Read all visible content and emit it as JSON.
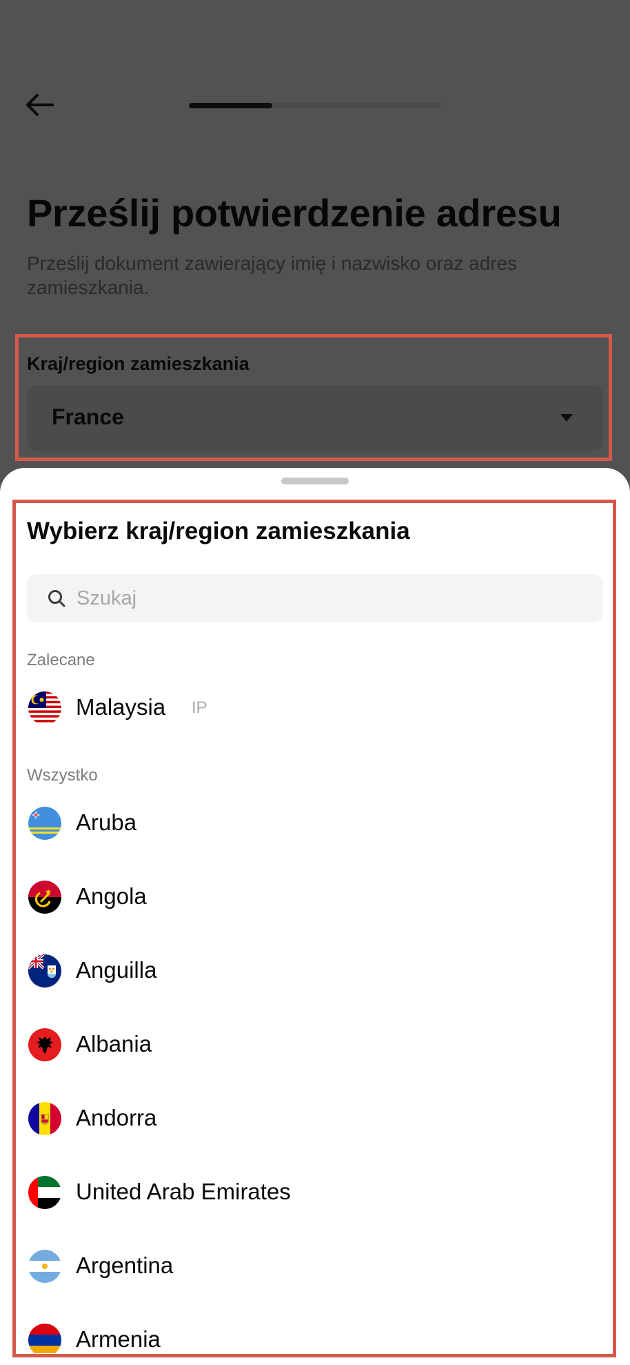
{
  "header": {
    "progress_fraction": 0.33
  },
  "page": {
    "title": "Prześlij potwierdzenie adresu",
    "subtitle": "Prześlij dokument zawierający imię i nazwisko oraz adres zamieszkania."
  },
  "field": {
    "label": "Kraj/region zamieszkania",
    "value": "France"
  },
  "sheet": {
    "title": "Wybierz kraj/region zamieszkania",
    "search_placeholder": "Szukaj",
    "recommended_label": "Zalecane",
    "all_label": "Wszystko",
    "recommended": [
      {
        "name": "Malaysia",
        "badge": "IP",
        "flag_icon": "flag-malaysia-icon"
      }
    ],
    "countries": [
      {
        "name": "Aruba",
        "flag_icon": "flag-aruba-icon"
      },
      {
        "name": "Angola",
        "flag_icon": "flag-angola-icon"
      },
      {
        "name": "Anguilla",
        "flag_icon": "flag-anguilla-icon"
      },
      {
        "name": "Albania",
        "flag_icon": "flag-albania-icon"
      },
      {
        "name": "Andorra",
        "flag_icon": "flag-andorra-icon"
      },
      {
        "name": "United Arab Emirates",
        "flag_icon": "flag-uae-icon"
      },
      {
        "name": "Argentina",
        "flag_icon": "flag-argentina-icon"
      },
      {
        "name": "Armenia",
        "flag_icon": "flag-armenia-icon"
      }
    ]
  },
  "colors": {
    "overlay": "#525252",
    "highlight_border": "#d5594b",
    "sheet_bg": "#ffffff",
    "search_bg": "#f3f4f5"
  }
}
